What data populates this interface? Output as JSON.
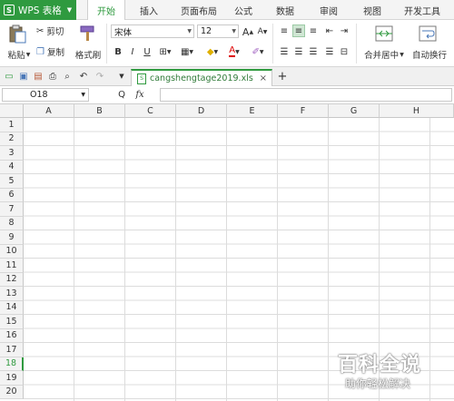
{
  "app": {
    "menu_button": "WPS 表格",
    "logo": "S"
  },
  "tabs": [
    "开始",
    "插入",
    "页面布局",
    "公式",
    "数据",
    "审阅",
    "视图",
    "开发工具"
  ],
  "ribbon": {
    "paste": "粘贴",
    "cut": "剪切",
    "copy": "复制",
    "format_painter": "格式刷",
    "font_name": "宋体",
    "font_size": "12",
    "bold": "B",
    "italic": "I",
    "underline": "U",
    "font_color_glyph": "A",
    "grow_font": "A",
    "shrink_font": "A",
    "merge_center": "合并居中",
    "wrap_text": "自动换行"
  },
  "document": {
    "filename": "cangshengtage2019.xls",
    "close": "×",
    "new_tab": "+"
  },
  "formula_bar": {
    "cell_ref": "O18",
    "fx": "fx",
    "zoom_glyph": "Q"
  },
  "columns": [
    "A",
    "B",
    "C",
    "D",
    "E",
    "F",
    "G",
    "H"
  ],
  "rows": [
    "1",
    "2",
    "3",
    "4",
    "5",
    "6",
    "7",
    "8",
    "9",
    "10",
    "11",
    "12",
    "13",
    "14",
    "15",
    "16",
    "17",
    "18",
    "19",
    "20"
  ],
  "selected_row": "18",
  "watermark": {
    "title": "百科全说",
    "subtitle": "助你轻松解决"
  },
  "colors": {
    "accent": "#2f9a3f"
  }
}
